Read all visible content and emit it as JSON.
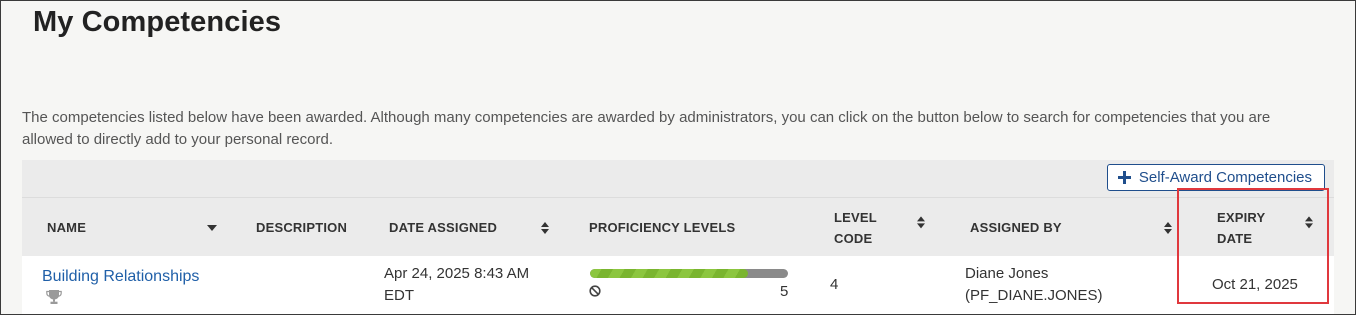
{
  "page": {
    "title": "My Competencies",
    "intro": "The competencies listed below have been awarded. Although many competencies are awarded by administrators, you can click on the button below to search for competencies that you are allowed to directly add to your personal record."
  },
  "toolbar": {
    "self_award_label": "Self-Award Competencies",
    "self_award_icon": "plus-icon"
  },
  "table": {
    "columns": {
      "name": "NAME",
      "description": "DESCRIPTION",
      "date_assigned": "DATE ASSIGNED",
      "proficiency_levels": "PROFICIENCY LEVELS",
      "level_code_line1": "LEVEL",
      "level_code_line2": "CODE",
      "assigned_by": "ASSIGNED BY",
      "expiry_line1": "EXPIRY",
      "expiry_line2": "DATE"
    },
    "rows": [
      {
        "name": "Building Relationships",
        "description": "",
        "date_assigned_line1": "Apr 24, 2025 8:43 AM",
        "date_assigned_line2": "EDT",
        "proficiency_value": 4,
        "proficiency_max": "5",
        "proficiency_fraction": 0.8,
        "level_code": "4",
        "assigned_by_line1": "Diane Jones",
        "assigned_by_line2": "(PF_DIANE.JONES)",
        "expiry_date": "Oct 21, 2025"
      }
    ]
  },
  "colors": {
    "link": "#1f5fa8",
    "button_accent": "#1f4e8c",
    "progress_fill": "#8cc63f",
    "progress_track": "#8a8a8a",
    "highlight_border": "#e0383d"
  }
}
